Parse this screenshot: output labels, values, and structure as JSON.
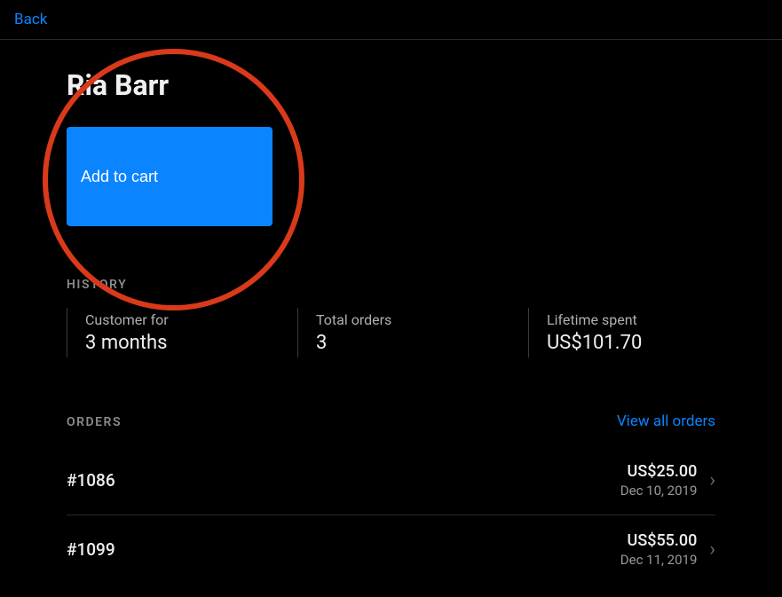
{
  "header": {
    "back_label": "Back"
  },
  "customer": {
    "name": "Ria Barr"
  },
  "actions": {
    "add_to_cart_label": "Add to cart"
  },
  "history": {
    "label": "HISTORY",
    "stats": [
      {
        "label": "Customer for",
        "value": "3 months"
      },
      {
        "label": "Total orders",
        "value": "3"
      },
      {
        "label": "Lifetime spent",
        "value": "US$101.70"
      }
    ]
  },
  "orders_section": {
    "label": "ORDERS",
    "view_all_label": "View all orders",
    "orders": [
      {
        "id": "#1086",
        "amount": "US$25.00",
        "date": "Dec 10, 2019"
      },
      {
        "id": "#1099",
        "amount": "US$55.00",
        "date": "Dec 11, 2019"
      }
    ]
  }
}
